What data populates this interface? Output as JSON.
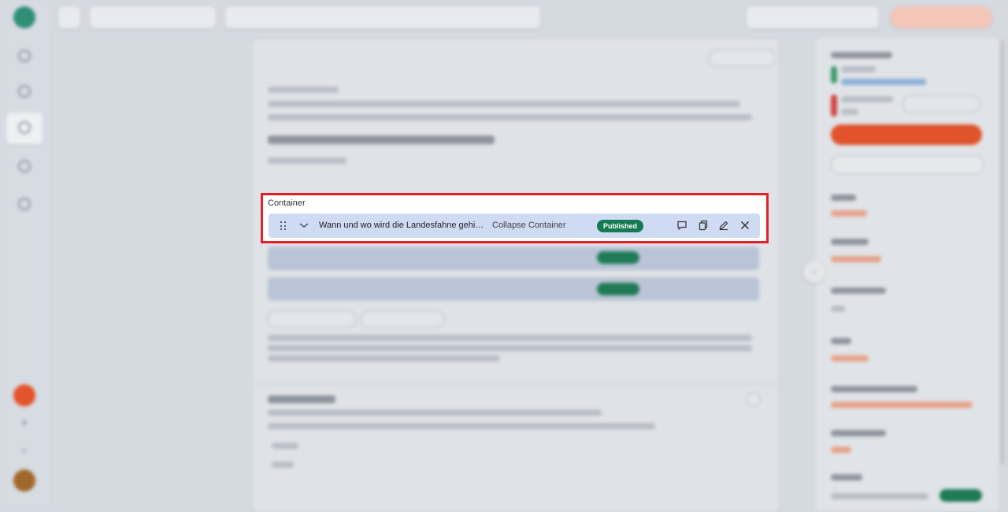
{
  "focus": {
    "section_label": "Container",
    "row": {
      "title": "Wann und wo wird die Landesfahne gehisst? ...",
      "collapse_label": "Collapse Container",
      "status_badge": "Published"
    },
    "actions": [
      "comment-icon",
      "duplicate-icon",
      "edit-icon",
      "close-icon"
    ]
  },
  "colors": {
    "highlight": "#e3202a",
    "badge": "#137a52",
    "row_bg": "#cfdaf3",
    "accent": "#e0532b"
  }
}
